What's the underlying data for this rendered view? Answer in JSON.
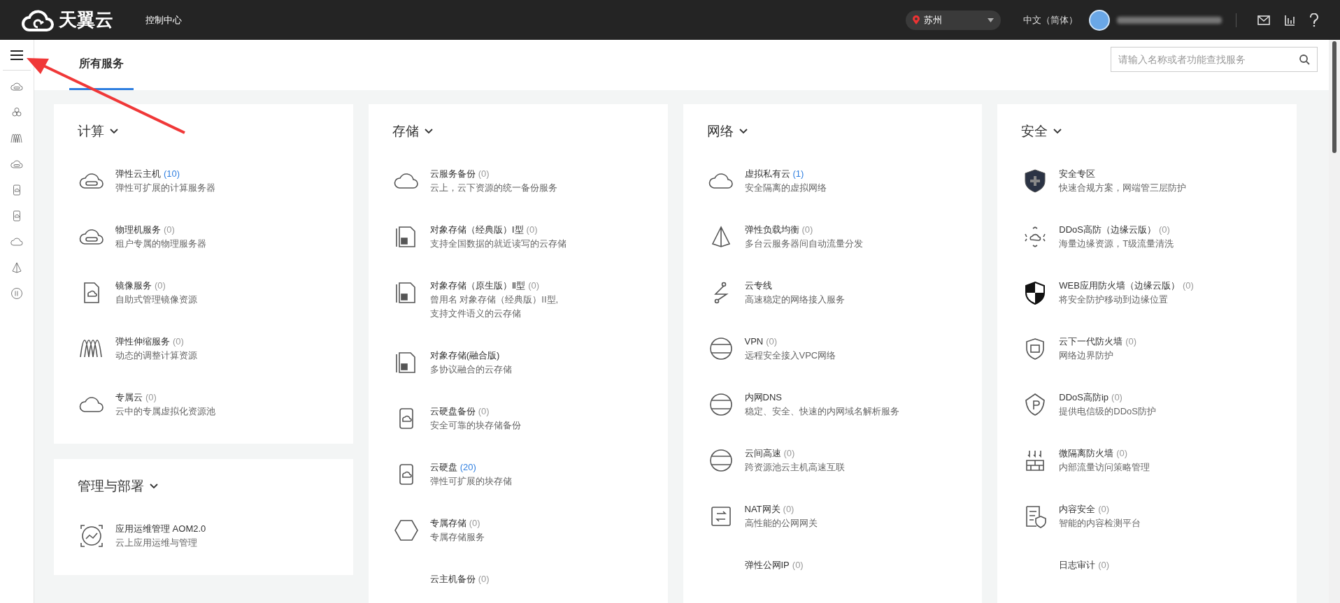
{
  "header": {
    "logo": "天翼云",
    "console": "控制中心",
    "region": "苏州",
    "language": "中文（简体）"
  },
  "tabs": [
    {
      "label": "所有服务",
      "selected": true
    }
  ],
  "search": {
    "placeholder": "请输入名称或者功能查找服务"
  },
  "columns": [
    {
      "sections": [
        {
          "title": "计算",
          "items": [
            {
              "name": "弹性云主机",
              "count": "(10)",
              "highlighted": true,
              "desc": [
                "弹性可扩展的计算服务器"
              ]
            },
            {
              "name": "物理机服务",
              "count": "(0)",
              "highlighted": false,
              "desc": [
                "租户专属的物理服务器"
              ]
            },
            {
              "name": "镜像服务",
              "count": "(0)",
              "highlighted": false,
              "desc": [
                "自助式管理镜像资源"
              ]
            },
            {
              "name": "弹性伸缩服务",
              "count": "(0)",
              "highlighted": false,
              "desc": [
                "动态的调整计算资源"
              ]
            },
            {
              "name": "专属云",
              "count": "(0)",
              "highlighted": false,
              "desc": [
                "云中的专属虚拟化资源池"
              ]
            }
          ]
        },
        {
          "title": "管理与部署",
          "items": [
            {
              "name": "应用运维管理 AOM2.0",
              "desc": [
                "云上应用运维与管理"
              ]
            }
          ]
        }
      ]
    },
    {
      "sections": [
        {
          "title": "存储",
          "items": [
            {
              "name": "云服务备份",
              "count": "(0)",
              "highlighted": false,
              "desc": [
                "云上，云下资源的统一备份服务"
              ]
            },
            {
              "name": "对象存储（经典版）Ⅰ型",
              "count": "(0)",
              "highlighted": false,
              "desc": [
                "支持全国数据的就近读写的云存储"
              ]
            },
            {
              "name": "对象存储（原生版）Ⅱ型",
              "count": "(0)",
              "highlighted": false,
              "desc": [
                "曾用名 对象存储（经典版）II型,",
                "支持文件语义的云存储"
              ]
            },
            {
              "name": "对象存储(融合版)",
              "desc": [
                "多协议融合的云存储"
              ]
            },
            {
              "name": "云硬盘备份",
              "count": "(0)",
              "highlighted": false,
              "desc": [
                "安全可靠的块存储备份"
              ]
            },
            {
              "name": "云硬盘",
              "count": "(20)",
              "highlighted": true,
              "desc": [
                "弹性可扩展的块存储"
              ]
            },
            {
              "name": "专属存储",
              "count": "(0)",
              "highlighted": false,
              "desc": [
                "专属存储服务"
              ]
            },
            {
              "name": "云主机备份",
              "count": "(0)",
              "highlighted": false
            }
          ]
        }
      ]
    },
    {
      "sections": [
        {
          "title": "网络",
          "items": [
            {
              "name": "虚拟私有云",
              "count": "(1)",
              "highlighted": true,
              "desc": [
                "安全隔离的虚拟网络"
              ]
            },
            {
              "name": "弹性负载均衡",
              "count": "(0)",
              "highlighted": false,
              "desc": [
                "多台云服务器间自动流量分发"
              ]
            },
            {
              "name": "云专线",
              "desc": [
                "高速稳定的网络接入服务"
              ]
            },
            {
              "name": "VPN",
              "count": "(0)",
              "highlighted": false,
              "desc": [
                "远程安全接入VPC网络"
              ]
            },
            {
              "name": "内网DNS",
              "desc": [
                "稳定、安全、快速的内网域名解析服务"
              ]
            },
            {
              "name": "云间高速",
              "count": "(0)",
              "highlighted": false,
              "desc": [
                "跨资源池云主机高速互联"
              ]
            },
            {
              "name": "NAT网关",
              "count": "(0)",
              "highlighted": false,
              "desc": [
                "高性能的公网网关"
              ]
            },
            {
              "name": "弹性公网IP",
              "count": "(0)",
              "highlighted": false
            }
          ]
        }
      ]
    },
    {
      "sections": [
        {
          "title": "安全",
          "items": [
            {
              "name": "安全专区",
              "desc": [
                "快速合规方案，网端管三层防护"
              ]
            },
            {
              "name": "DDoS高防（边缘云版）",
              "count": "(0)",
              "highlighted": false,
              "desc": [
                "海量边缘资源，T级流量清洗"
              ]
            },
            {
              "name": "WEB应用防火墙（边缘云版）",
              "count": "(0)",
              "highlighted": false,
              "desc": [
                "将安全防护移动到边缘位置"
              ]
            },
            {
              "name": "云下一代防火墙",
              "count": "(0)",
              "highlighted": false,
              "desc": [
                "网络边界防护"
              ]
            },
            {
              "name": "DDoS高防ip",
              "count": "(0)",
              "highlighted": false,
              "desc": [
                "提供电信级的DDoS防护"
              ]
            },
            {
              "name": "微隔离防火墙",
              "count": "(0)",
              "highlighted": false,
              "desc": [
                "内部流量访问策略管理"
              ]
            },
            {
              "name": "内容安全",
              "count": "(0)",
              "highlighted": false,
              "desc": [
                "智能的内容检测平台"
              ]
            },
            {
              "name": "日志审计",
              "count": "(0)",
              "highlighted": false
            }
          ]
        }
      ]
    }
  ]
}
